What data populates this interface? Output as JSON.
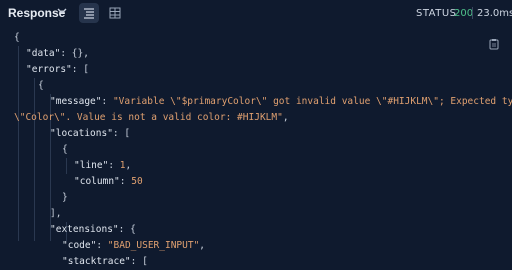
{
  "header": {
    "title": "Response",
    "status_label": "STATUS",
    "status_code": "200",
    "time": "23.0ms"
  },
  "icons": {
    "chevron": "chevron-down-icon",
    "view_text": "text-view-icon",
    "view_table": "table-view-icon",
    "copy": "clipboard-icon"
  },
  "colors": {
    "background": "#0f1a2e",
    "status_ok": "#4ec08a",
    "string": "#e0a070"
  },
  "code": {
    "l1": "{",
    "l2_key": "\"data\"",
    "l2_rest": ": {},",
    "l3_key": "\"errors\"",
    "l3_rest": ": [",
    "l4": "{",
    "l5_key": "\"message\"",
    "l5_sep": ": ",
    "l5_val": "\"Variable \\\"$primaryColor\\\" got invalid value \\\"#HIJKLM\\\"; Expected type",
    "l6_val": "\\\"Color\\\". Value is not a valid color: #HIJKLM\"",
    "l6_rest": ",",
    "l7_key": "\"locations\"",
    "l7_rest": ": [",
    "l8": "{",
    "l9_key": "\"line\"",
    "l9_sep": ": ",
    "l9_val": "1",
    "l9_rest": ",",
    "l10_key": "\"column\"",
    "l10_sep": ": ",
    "l10_val": "50",
    "l11": "}",
    "l12": "],",
    "l13_key": "\"extensions\"",
    "l13_rest": ": {",
    "l14_key": "\"code\"",
    "l14_sep": ": ",
    "l14_val": "\"BAD_USER_INPUT\"",
    "l14_rest": ",",
    "l15_key": "\"stacktrace\"",
    "l15_rest": ": ["
  }
}
